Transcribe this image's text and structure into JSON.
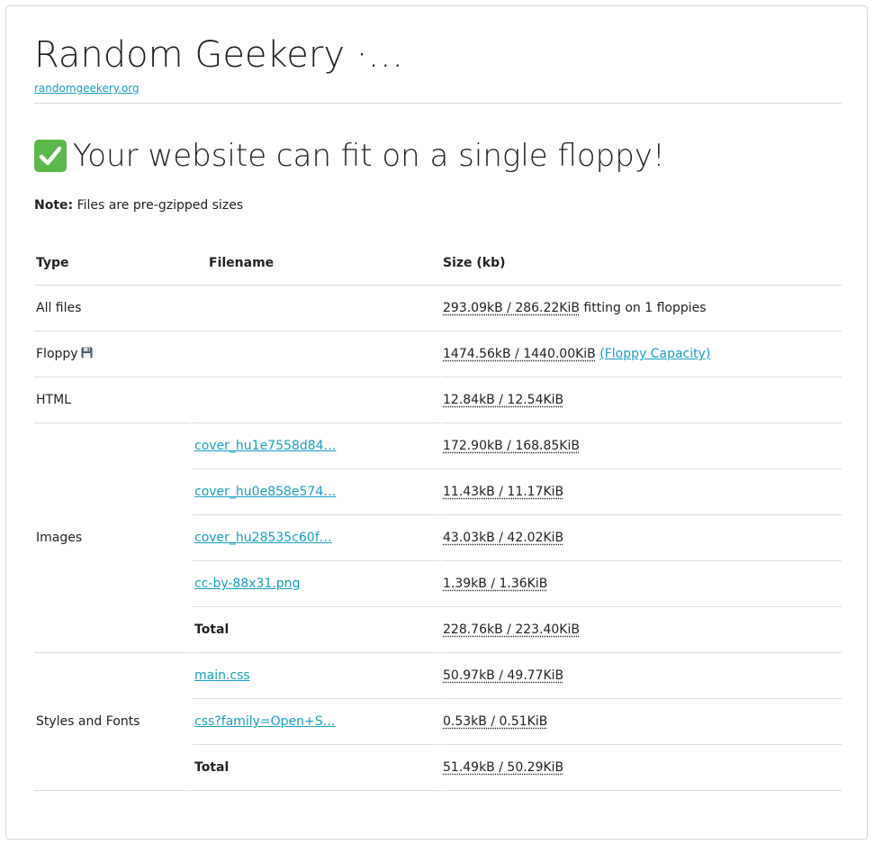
{
  "site": {
    "title": "Random Geekery ·…",
    "link": "randomgeekery.org"
  },
  "headline": {
    "icon": "check-mark-icon",
    "text": "Your website can fit on a single floppy!"
  },
  "note": {
    "label": "Note:",
    "text": " Files are pre-gzipped sizes"
  },
  "table": {
    "headers": [
      "Type",
      "Filename",
      "Size (kb)"
    ],
    "all_files": {
      "type": "All files",
      "size": "293.09kB / 286.22KiB",
      "suffix": " fitting on 1 floppies"
    },
    "floppy": {
      "type": "Floppy",
      "icon": "floppy-disk-icon",
      "size": "1474.56kB / 1440.00KiB",
      "link": "(Floppy Capacity)"
    },
    "html": {
      "type": "HTML",
      "size": "12.84kB / 12.54KiB"
    },
    "images": {
      "type": "Images",
      "files": [
        {
          "name": "cover_hu1e7558d84…",
          "size": "172.90kB / 168.85KiB"
        },
        {
          "name": "cover_hu0e858e574…",
          "size": "11.43kB / 11.17KiB"
        },
        {
          "name": "cover_hu28535c60f…",
          "size": "43.03kB / 42.02KiB"
        },
        {
          "name": "cc-by-88x31.png",
          "size": "1.39kB / 1.36KiB"
        }
      ],
      "total_label": "Total",
      "total": "228.76kB / 223.40KiB"
    },
    "styles": {
      "type": "Styles and Fonts",
      "files": [
        {
          "name": "main.css",
          "size": "50.97kB / 49.77KiB"
        },
        {
          "name": "css?family=Open+S…",
          "size": "0.53kB / 0.51KiB"
        }
      ],
      "total_label": "Total",
      "total": "51.49kB / 50.29KiB"
    }
  },
  "colors": {
    "link": "#1a9fc2",
    "check_bg": "#5bb84a"
  }
}
